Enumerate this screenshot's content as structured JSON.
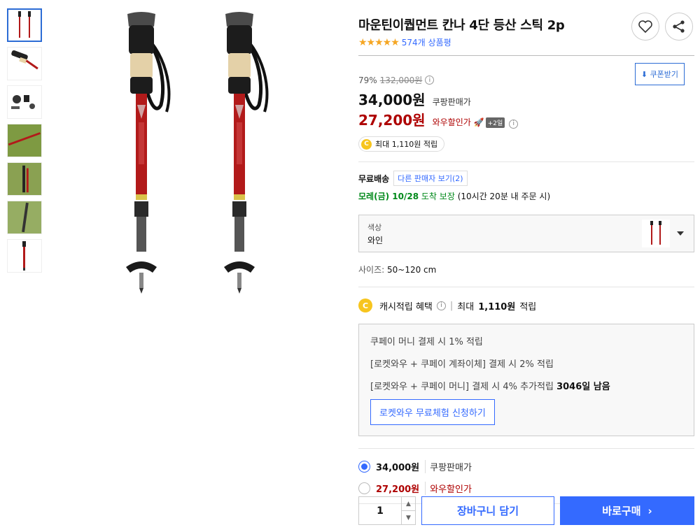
{
  "product": {
    "title": "마운틴이퀍먼트 칸나 4단 등산 스틱 2p",
    "stars": "★★★★★",
    "review_count": "574개 상품평",
    "rating_fraction": 0.9
  },
  "price": {
    "discount_rate": "79%",
    "original": "132,000원",
    "coupang_price": "34,000원",
    "coupang_label": "쿠팡판매가",
    "wow_price": "27,200원",
    "wow_label": "와우할인가",
    "wow_badge": "+2일",
    "coupon_button": "쿠폰받기",
    "max_points": "최대 1,110원 적립"
  },
  "shipping": {
    "free": "무료배송",
    "other_sellers": "다른 판매자 보기(2)",
    "arrival_date": "모레(금) 10/28",
    "arrival_guarantee": "도착 보장",
    "arrival_note": "(10시간 20분 내 주문 시)"
  },
  "option": {
    "label": "색상",
    "value": "와인"
  },
  "size": {
    "label": "사이즈:",
    "value": "50~120 cm"
  },
  "cash": {
    "label": "캐시적립 혜택",
    "max_prefix": "최대",
    "max_amount": "1,110원",
    "max_suffix": "적립"
  },
  "benefits": {
    "line1": "쿠페이 머니 결제 시 1% 적립",
    "line2": "[로켓와우 + 쿠페이 계좌이체] 결제 시 2% 적립",
    "line3_text": "[로켓와우 + 쿠페이 머니] 결제 시 4% 추가적립",
    "line3_days": "3046일 남음",
    "wow_trial_button": "로켓와우 무료체험 신청하기"
  },
  "radio_options": [
    {
      "price": "34,000원",
      "label": "쿠팡판매가",
      "selected": true
    },
    {
      "price": "27,200원",
      "label": "와우할인가",
      "selected": false
    }
  ],
  "purchase": {
    "quantity": "1",
    "cart_button": "장바구니 담기",
    "buy_button": "바로구매"
  },
  "colors": {
    "accent": "#346aff",
    "wow_red": "#ae0000",
    "pole_red": "#b21a1a",
    "arrival_green": "#00891a"
  }
}
